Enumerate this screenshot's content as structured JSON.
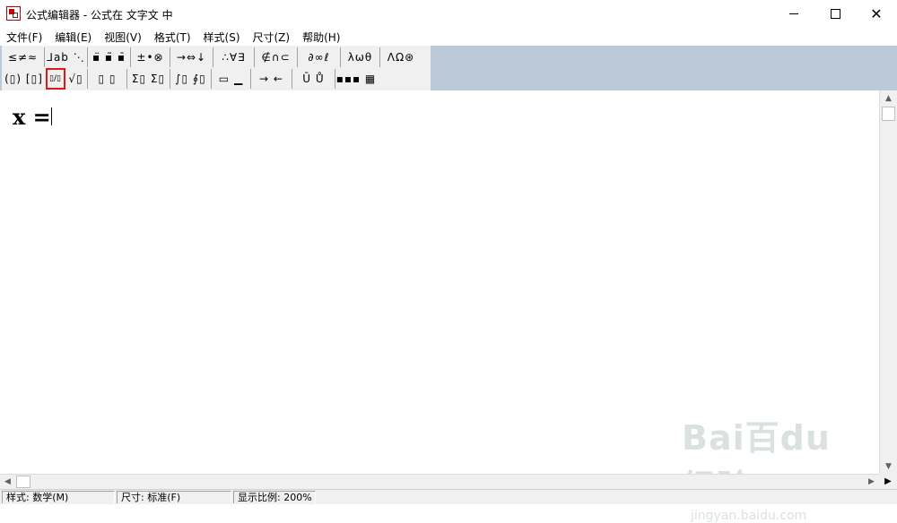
{
  "window": {
    "title": "公式编辑器 - 公式在 文字文 中",
    "controls": {
      "minimize": "—",
      "maximize": "☐",
      "close": "✕"
    }
  },
  "menu": [
    "文件(F)",
    "编辑(E)",
    "视图(V)",
    "格式(T)",
    "样式(S)",
    "尺寸(Z)",
    "帮助(H)"
  ],
  "toolbar": {
    "row1": [
      "≤≠≈",
      "⅃ab ⋱",
      "▪̈ ▪̃ ▪̄",
      "±•⊗",
      "→⇔↓",
      "∴∀∃",
      "∉∩⊂",
      "∂∞ℓ",
      "λωθ",
      "ΛΩ⊛"
    ],
    "row2": [
      "(▯) [▯]",
      "▯/▯",
      "√▯",
      "▯ ▯",
      "Σ▯ Σ▯",
      "∫▯ ∮▯",
      "▭ ▁",
      "→ ←",
      "Ū Ů",
      "▪▪▪ ▦"
    ],
    "selected": "fraction-button"
  },
  "document": {
    "equation": "x ="
  },
  "statusbar": {
    "style": "样式: 数学(M)",
    "size": "尺寸: 标准(F)",
    "zoom": "显示比例: 200%"
  },
  "watermark": {
    "logo": "Bai百du 经验",
    "url": "jingyan.baidu.com"
  }
}
